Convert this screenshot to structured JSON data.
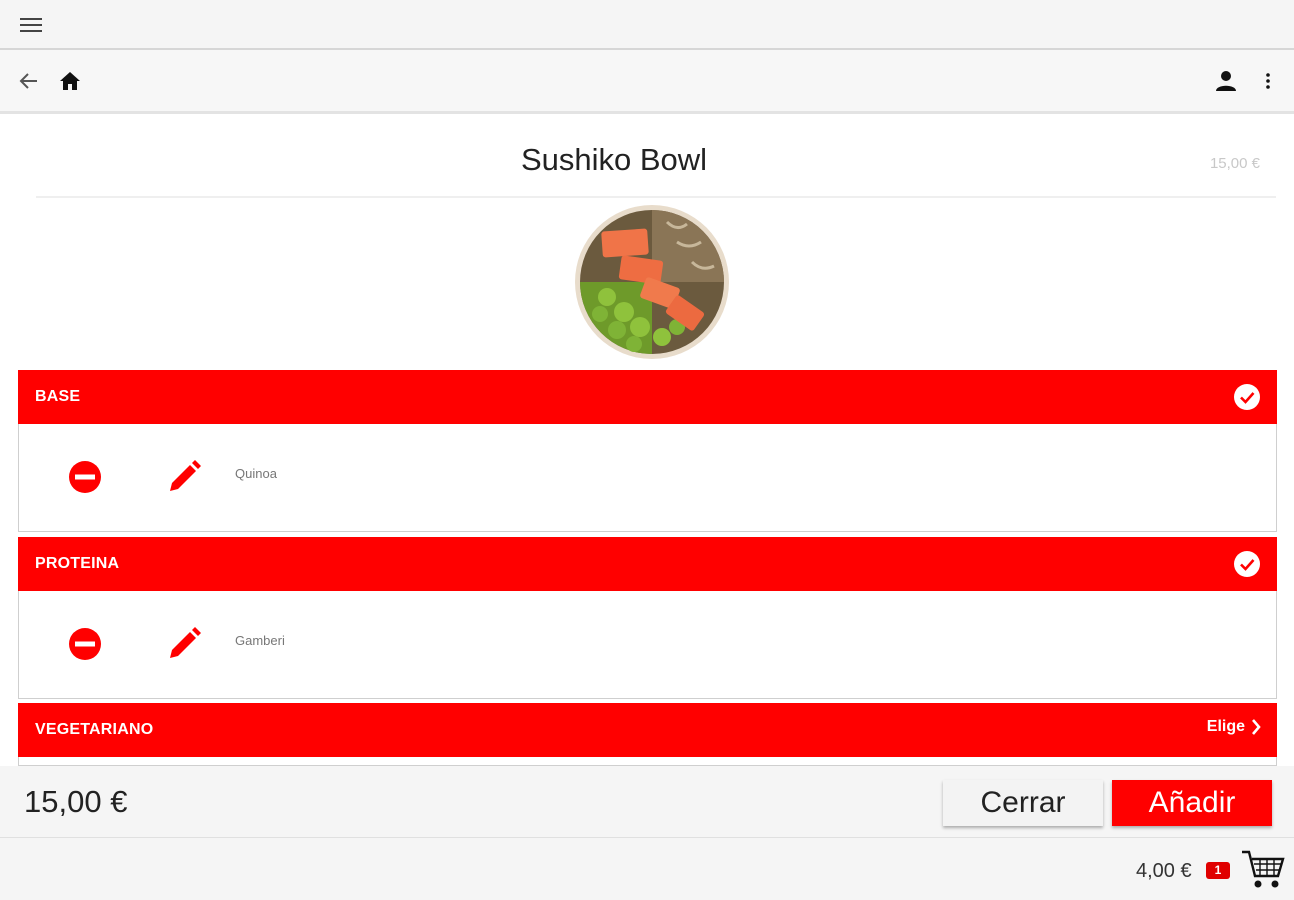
{
  "topbar": {
    "menu_icon": "hamburger-icon"
  },
  "navbar": {
    "back_icon": "arrow-left-icon",
    "home_icon": "home-icon",
    "account_icon": "person-icon",
    "more_icon": "more-vert-icon"
  },
  "product": {
    "title": "Sushiko Bowl",
    "price": "15,00 €",
    "image": "poke-bowl-salmon-edamame"
  },
  "sections": [
    {
      "label": "BASE",
      "status": "check-circle-icon",
      "item": "Quinoa"
    },
    {
      "label": "PROTEINA",
      "status": "check-circle-icon",
      "item": "Gamberi"
    },
    {
      "label": "VEGETARIANO",
      "choose_label": "Elige"
    }
  ],
  "action_bar": {
    "total": "15,00 €",
    "close_label": "Cerrar",
    "add_label": "Añadir"
  },
  "footer": {
    "cart_total": "4,00 €",
    "cart_count": "1",
    "cart_icon": "shopping-cart-icon"
  },
  "colors": {
    "accent": "#ff0000",
    "bar_bg": "#f5f5f5"
  }
}
